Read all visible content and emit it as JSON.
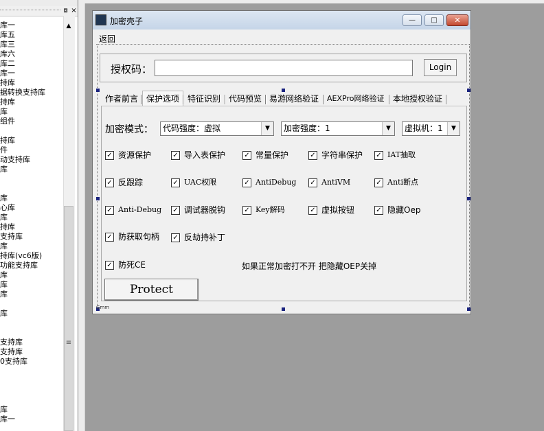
{
  "left_panel": {
    "pin_icon": "⧈",
    "close_icon": "×",
    "up_arrow": "▲",
    "grip": "≡",
    "items": [
      "库一",
      "库五",
      "库三",
      "库六",
      "库二",
      "库一",
      "持库",
      "据转换支持库",
      "持库",
      "库",
      "组件",
      "",
      "持库",
      "件",
      "动支持库",
      "库",
      "",
      "",
      "库",
      "心库",
      "库",
      "持库",
      "支持库",
      "库",
      "持库(vc6版)",
      "功能支持库",
      "库",
      "库",
      "库",
      "",
      "库",
      "",
      "",
      "支持库",
      "支持库",
      "0支持库",
      "",
      "",
      "",
      "",
      "库",
      "库一"
    ]
  },
  "dialog": {
    "title": "加密壳子",
    "minimize": "—",
    "restore": "□",
    "close": "✕",
    "menu_back": "返回",
    "auth_label": "授权码：",
    "auth_value": "",
    "login": "Login",
    "tabs": [
      "作者前言",
      "保护选项",
      "特征识别",
      "代码预览",
      "易游网络验证",
      "AEXPro网络验证",
      "本地授权验证"
    ],
    "active_tab": 1,
    "enc_mode_label": "加密模式：",
    "combo_code": "代码强度：虚拟",
    "combo_strength": "加密强度：1",
    "combo_vm": "虚拟机：1",
    "combo_arrow": "▼",
    "check_mark": "✓",
    "options": [
      [
        "资源保护",
        "导入表保护",
        "常量保护",
        "字符串保护",
        "IAT抽取"
      ],
      [
        "反跟踪",
        "UAC权限",
        "AntiDebug",
        "AntiVM",
        "Anti断点"
      ],
      [
        "Anti-Debug",
        "调试器脱钩",
        "Key解码",
        "虚拟按钮",
        "隐藏Oep"
      ],
      [
        "防获取句柄",
        "反劫持补丁"
      ],
      [
        "防死CE"
      ]
    ],
    "hint": "如果正常加密打不开 把隐藏OEP关掉",
    "protect": "Protect",
    "corner_label": "Gmm"
  }
}
